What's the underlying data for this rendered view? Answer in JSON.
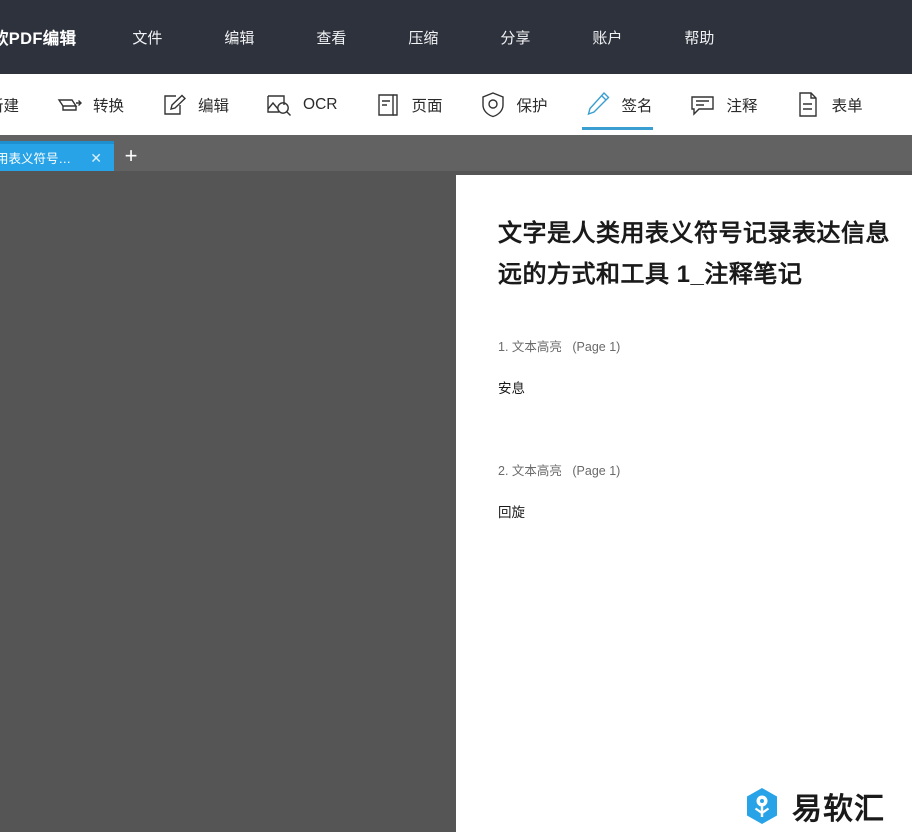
{
  "app": {
    "title": "软PDF编辑"
  },
  "menu": {
    "items": [
      {
        "label": "文件",
        "name": "menu-file"
      },
      {
        "label": "编辑",
        "name": "menu-edit"
      },
      {
        "label": "查看",
        "name": "menu-view"
      },
      {
        "label": "压缩",
        "name": "menu-compress"
      },
      {
        "label": "分享",
        "name": "menu-share"
      },
      {
        "label": "账户",
        "name": "menu-account"
      },
      {
        "label": "帮助",
        "name": "menu-help"
      }
    ]
  },
  "toolbar": {
    "items": [
      {
        "label": "新建",
        "icon": "new-document-icon",
        "active": false
      },
      {
        "label": "转换",
        "icon": "convert-icon",
        "active": false
      },
      {
        "label": "编辑",
        "icon": "edit-pencil-icon",
        "active": false
      },
      {
        "label": "OCR",
        "icon": "ocr-scan-icon",
        "active": false
      },
      {
        "label": "页面",
        "icon": "pages-icon",
        "active": false
      },
      {
        "label": "保护",
        "icon": "shield-protect-icon",
        "active": false
      },
      {
        "label": "签名",
        "icon": "signature-pen-icon",
        "active": true
      },
      {
        "label": "注释",
        "icon": "comment-icon",
        "active": false
      },
      {
        "label": "表单",
        "icon": "form-icon",
        "active": false
      }
    ],
    "active_accent": "#3a9fd0"
  },
  "tabstrip": {
    "active_tab_label": "用表义符号…",
    "close_glyph": "✕",
    "new_tab_glyph": "+",
    "active_tab_color": "#29a3e8"
  },
  "document": {
    "title_line1": "文字是人类用表义符号记录表达信息",
    "title_line2": "远的方式和工具 1_注释笔记",
    "annotations": [
      {
        "index": "1. 文本高亮",
        "page": "(Page 1)",
        "text": "安息"
      },
      {
        "index": "2. 文本高亮",
        "page": "(Page 1)",
        "text": "回旋"
      }
    ]
  },
  "watermark": {
    "text": "易软汇",
    "color": "#29a3e8"
  }
}
